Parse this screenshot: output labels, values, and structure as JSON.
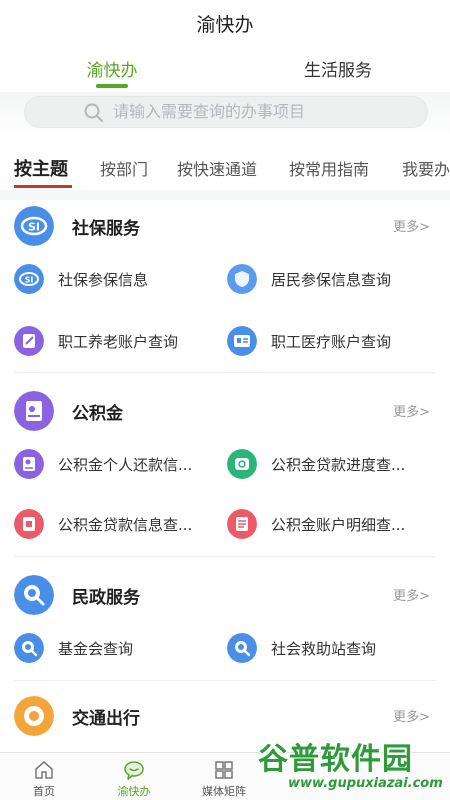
{
  "app": {
    "title": "渝快办"
  },
  "top_tabs": [
    {
      "label": "渝快办",
      "active": true
    },
    {
      "label": "生活服务",
      "active": false
    }
  ],
  "search": {
    "placeholder": "请输入需要查询的办事项目"
  },
  "category_tabs": [
    {
      "label": "按主题",
      "active": true
    },
    {
      "label": "按部门"
    },
    {
      "label": "按快速通道"
    },
    {
      "label": "按常用指南"
    },
    {
      "label": "我要办"
    }
  ],
  "sections": [
    {
      "title": "社保服务",
      "more": "更多>",
      "icon": "social-security-icon",
      "color": "#4a8fe7",
      "items": [
        {
          "label": "社保参保信息",
          "icon": "social-security-icon",
          "color": "#4a8fe7"
        },
        {
          "label": "居民参保信息查询",
          "icon": "shield-icon",
          "color": "#5b9bef"
        },
        {
          "label": "职工养老账户查询",
          "icon": "edit-document-icon",
          "color": "#8a63e0"
        },
        {
          "label": "职工医疗账户查询",
          "icon": "id-card-icon",
          "color": "#4a8fe7"
        }
      ]
    },
    {
      "title": "公积金",
      "more": "更多>",
      "icon": "housing-fund-icon",
      "color": "#8a63e0",
      "items": [
        {
          "label": "公积金个人还款信...",
          "icon": "document-icon",
          "color": "#8a63e0"
        },
        {
          "label": "公积金贷款进度查...",
          "icon": "loan-progress-icon",
          "color": "#2bb57a"
        },
        {
          "label": "公积金贷款信息查...",
          "icon": "loan-info-icon",
          "color": "#ec5a6a"
        },
        {
          "label": "公积金账户明细查...",
          "icon": "account-detail-icon",
          "color": "#ec5a6a"
        }
      ]
    },
    {
      "title": "民政服务",
      "more": "更多>",
      "icon": "civil-affairs-icon",
      "color": "#4a8fe7",
      "items": [
        {
          "label": "基金会查询",
          "icon": "search-circle-icon",
          "color": "#4a8fe7"
        },
        {
          "label": "社会救助站查询",
          "icon": "search-circle-icon",
          "color": "#4a8fe7"
        }
      ]
    },
    {
      "title": "交通出行",
      "more": "更多>",
      "icon": "traffic-icon",
      "color": "#f3a43a",
      "items": []
    }
  ],
  "bottom_nav": [
    {
      "label": "首页",
      "icon": "home-icon",
      "active": false
    },
    {
      "label": "渝快办",
      "icon": "chat-bubble-icon",
      "active": true
    },
    {
      "label": "媒体矩阵",
      "icon": "grid-icon",
      "active": false
    }
  ],
  "watermark": {
    "title": "谷普软件园",
    "url": "www.gupuxiazai.com"
  },
  "colors": {
    "accent": "#5aa524",
    "tab_indicator": "#c23b2a",
    "watermark": "#2f9a3a"
  }
}
